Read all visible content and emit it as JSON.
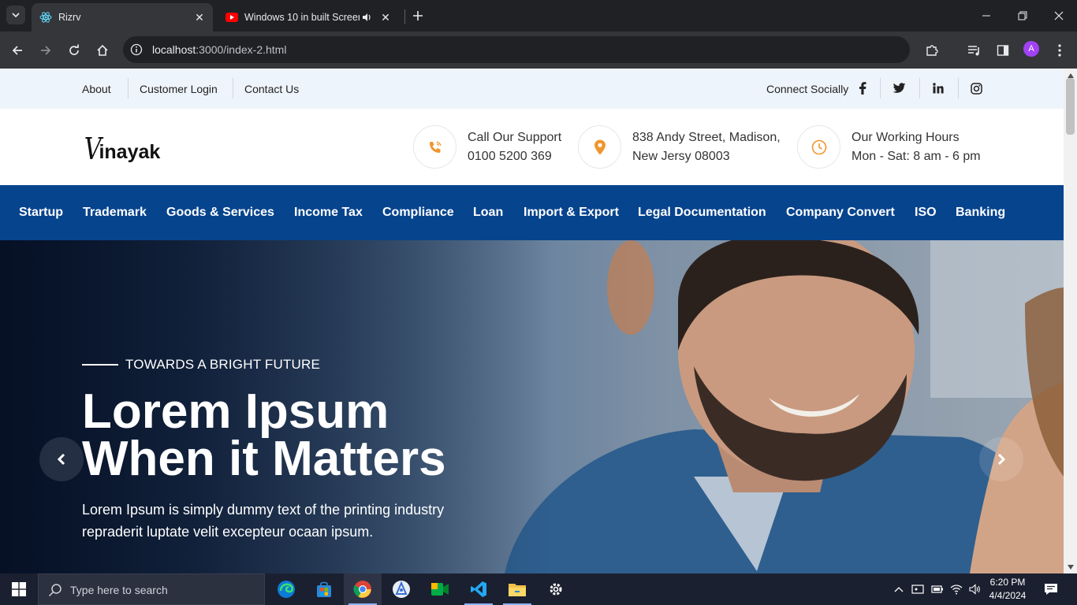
{
  "browser": {
    "tabs": [
      {
        "title": "Rizrv",
        "active": true,
        "favicon": "react-icon"
      },
      {
        "title": "Windows 10 in built Screen",
        "active": false,
        "favicon": "youtube-icon",
        "audio": true
      }
    ],
    "url_host": "localhost",
    "url_path": ":3000/index-2.html",
    "profile_initial": "A"
  },
  "topbar": {
    "links": [
      "About",
      "Customer Login",
      "Contact Us"
    ],
    "social_label": "Connect Socially",
    "social_icons": [
      "facebook-icon",
      "twitter-icon",
      "linkedin-icon",
      "instagram-icon"
    ]
  },
  "header": {
    "logo_v": "V",
    "logo_rest": "inayak",
    "support": {
      "line1": "Call Our Support",
      "line2": "0100 5200 369"
    },
    "address": {
      "line1": "838 Andy Street, Madison,",
      "line2": "New Jersy 08003"
    },
    "hours": {
      "line1": "Our Working Hours",
      "line2": "Mon - Sat: 8 am - 6 pm"
    },
    "accent_color": "#f0962e"
  },
  "nav": {
    "items": [
      "Startup",
      "Trademark",
      "Goods & Services",
      "Income Tax",
      "Compliance",
      "Loan",
      "Import & Export",
      "Legal Documentation",
      "Company Convert",
      "ISO",
      "Banking"
    ],
    "background": "#07448e"
  },
  "hero": {
    "tagline": "TOWARDS A BRIGHT FUTURE",
    "title_line1": "Lorem Ipsum",
    "title_line2": "When it Matters",
    "desc_line1": "Lorem Ipsum is simply dummy text of the printing industry",
    "desc_line2": "repraderit luptate velit excepteur ocaan ipsum."
  },
  "taskbar": {
    "search_placeholder": "Type here to search",
    "apps": [
      "edge-icon",
      "store-icon",
      "chrome-icon",
      "app-icon",
      "meet-icon",
      "vscode-icon",
      "file-explorer-icon",
      "settings-icon"
    ],
    "time": "6:20 PM",
    "date": "4/4/2024"
  }
}
